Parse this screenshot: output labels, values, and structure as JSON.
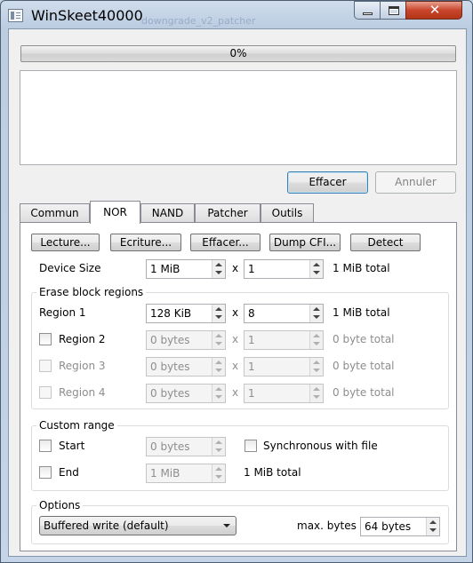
{
  "window": {
    "title": "WinSkeet40000",
    "background_ghost_text": "downgrade_v2_patcher"
  },
  "progress": {
    "value": 0,
    "label": "0%"
  },
  "actions": {
    "clear_label": "Effacer",
    "cancel_label": "Annuler"
  },
  "tabs": [
    {
      "label": "Commun",
      "active": false
    },
    {
      "label": "NOR",
      "active": true
    },
    {
      "label": "NAND",
      "active": false
    },
    {
      "label": "Patcher",
      "active": false
    },
    {
      "label": "Outils",
      "active": false
    }
  ],
  "nor": {
    "buttons": {
      "lecture": "Lecture...",
      "ecriture": "Ecriture...",
      "effacer": "Effacer...",
      "dump_cfi": "Dump CFI...",
      "detect": "Detect"
    },
    "multiply_sign": "x",
    "device_size": {
      "label": "Device Size",
      "value": "1 MiB",
      "count": "1",
      "total": "1 MiB total"
    },
    "erase_block_regions": {
      "title": "Erase block regions",
      "regions": [
        {
          "label": "Region 1",
          "has_checkbox": false,
          "enabled": true,
          "size": "128 KiB",
          "count": "8",
          "total": "1 MiB total"
        },
        {
          "label": "Region 2",
          "has_checkbox": true,
          "checked": false,
          "enabled": false,
          "size": "0 bytes",
          "count": "1",
          "total": "0 byte total"
        },
        {
          "label": "Region 3",
          "has_checkbox": true,
          "checked": false,
          "enabled": false,
          "size": "0 bytes",
          "count": "1",
          "total": "0 byte total"
        },
        {
          "label": "Region 4",
          "has_checkbox": true,
          "checked": false,
          "enabled": false,
          "size": "0 bytes",
          "count": "1",
          "total": "0 byte total"
        }
      ]
    },
    "custom_range": {
      "title": "Custom range",
      "start": {
        "label": "Start",
        "checked": false,
        "value": "0 bytes"
      },
      "end": {
        "label": "End",
        "checked": false,
        "value": "1 MiB"
      },
      "sync": {
        "label": "Synchronous with file",
        "checked": false
      },
      "total": "1 MiB total"
    },
    "options": {
      "title": "Options",
      "write_mode": "Buffered write (default)",
      "max_bytes_label": "max. bytes",
      "max_bytes_value": "64 bytes"
    }
  }
}
